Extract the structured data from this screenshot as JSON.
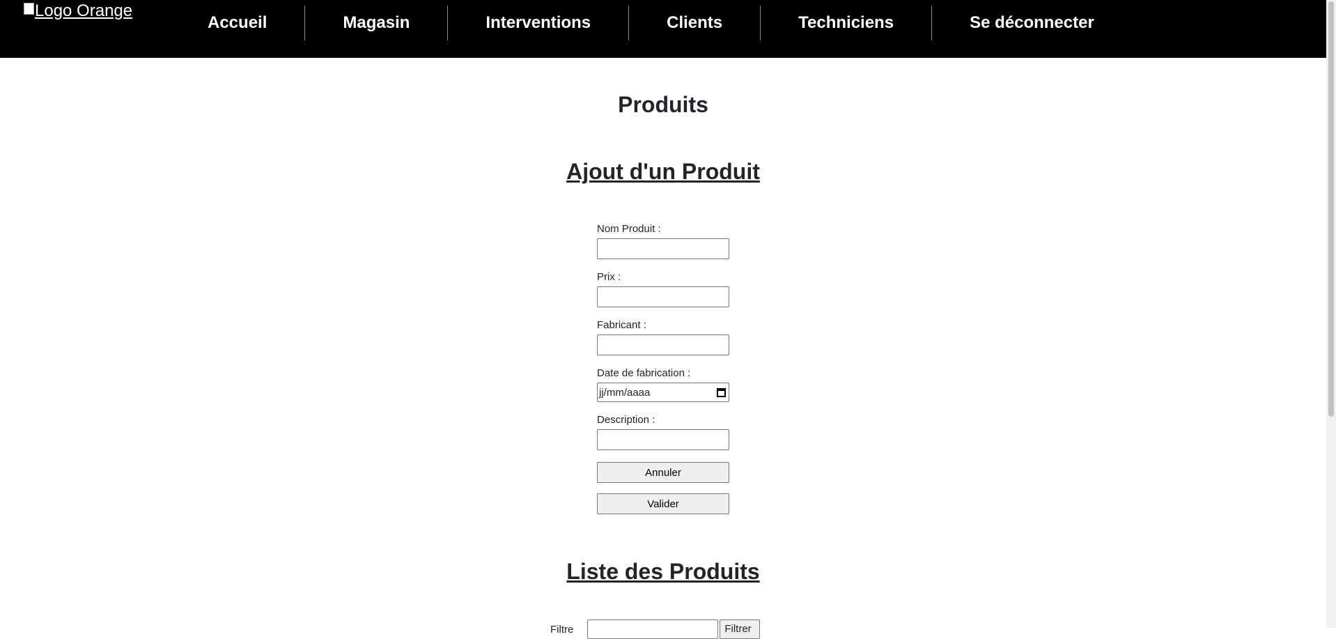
{
  "navbar": {
    "logo_alt": "Logo Orange",
    "items": [
      {
        "label": "Accueil"
      },
      {
        "label": "Magasin"
      },
      {
        "label": "Interventions"
      },
      {
        "label": "Clients"
      },
      {
        "label": "Techniciens"
      },
      {
        "label": "Se déconnecter"
      }
    ]
  },
  "page": {
    "title": "Produits"
  },
  "add_form": {
    "title": "Ajout d'un Produit",
    "fields": [
      {
        "label": "Nom Produit :",
        "value": ""
      },
      {
        "label": "Prix :",
        "value": ""
      },
      {
        "label": "Fabricant :",
        "value": ""
      },
      {
        "label": "Date de fabrication :",
        "placeholder": "jj/mm/aaaa"
      },
      {
        "label": "Description :",
        "value": ""
      }
    ],
    "cancel_label": "Annuler",
    "submit_label": "Valider"
  },
  "list": {
    "title": "Liste des Produits",
    "filter_label": "Filtre",
    "filter_button": "Filtrer"
  },
  "icons": {
    "date": "calendar-icon"
  }
}
